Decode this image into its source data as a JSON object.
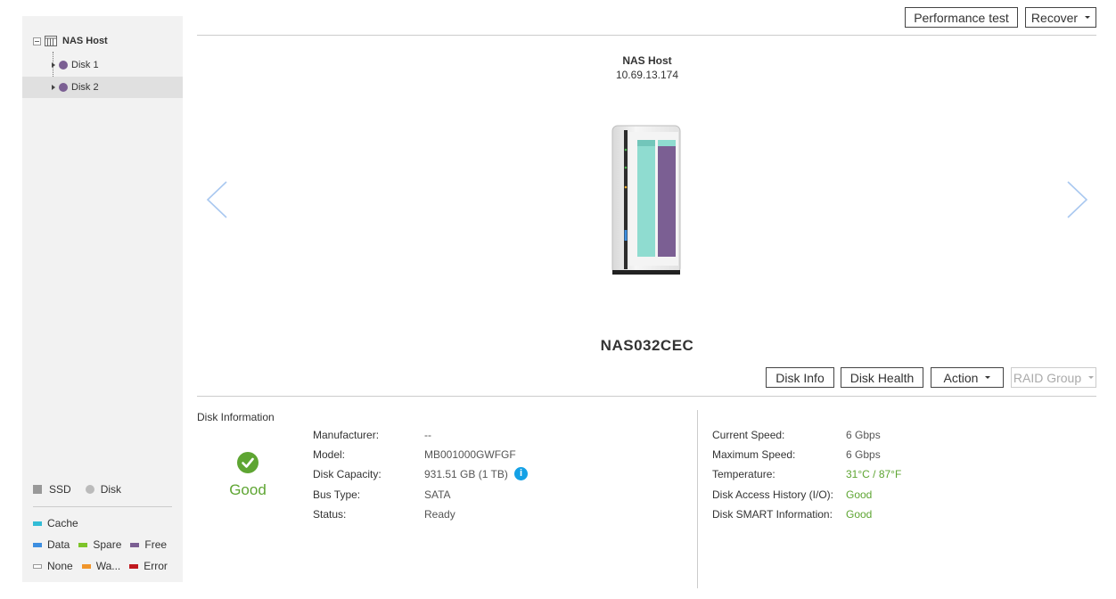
{
  "tree": {
    "root_label": "NAS Host",
    "items": [
      {
        "label": "Disk 1",
        "selected": false
      },
      {
        "label": "Disk 2",
        "selected": true
      }
    ]
  },
  "legend": {
    "types": [
      {
        "label": "SSD",
        "icon": "square-icon",
        "color": "#999999"
      },
      {
        "label": "Disk",
        "icon": "circle-icon",
        "color": "#bbbbbb"
      }
    ],
    "cache": {
      "label": "Cache",
      "color": "#33bcd6"
    },
    "row1": [
      {
        "label": "Data",
        "color": "#3d8ee0"
      },
      {
        "label": "Spare",
        "color": "#7dc42a"
      },
      {
        "label": "Free",
        "color": "#7b5f93"
      }
    ],
    "row2": [
      {
        "label": "None",
        "color": "#ffffff"
      },
      {
        "label": "Wa...",
        "color": "#f0952a"
      },
      {
        "label": "Error",
        "color": "#c0181e"
      }
    ]
  },
  "toolbar": {
    "performance_test": "Performance test",
    "recover": "Recover"
  },
  "host": {
    "title": "NAS Host",
    "ip": "10.69.13.174",
    "device_name": "NAS032CEC"
  },
  "disk_buttons": {
    "disk_info": "Disk Info",
    "disk_health": "Disk Health",
    "action": "Action",
    "raid_group": "RAID Group"
  },
  "disk_info": {
    "title": "Disk Information",
    "status_text": "Good",
    "left_fields": [
      {
        "label": "Manufacturer:",
        "value": "--"
      },
      {
        "label": "Model:",
        "value": "MB001000GWFGF"
      },
      {
        "label": "Disk Capacity:",
        "value": "931.51 GB (1 TB)"
      },
      {
        "label": "Bus Type:",
        "value": "SATA"
      },
      {
        "label": "Status:",
        "value": "Ready"
      }
    ],
    "right_fields": [
      {
        "label": "Current Speed:",
        "value": "6 Gbps"
      },
      {
        "label": "Maximum Speed:",
        "value": "6 Gbps"
      },
      {
        "label": "Temperature:",
        "value": "31°C / 87°F"
      },
      {
        "label": "Disk Access History (I/O):",
        "value": "Good"
      },
      {
        "label": "Disk SMART Information:",
        "value": "Good"
      }
    ]
  },
  "colors": {
    "good": "#5ea532",
    "info": "#14a1e6",
    "disk_free": "#7b5f93",
    "disk_cache": "#8fdcd0"
  }
}
